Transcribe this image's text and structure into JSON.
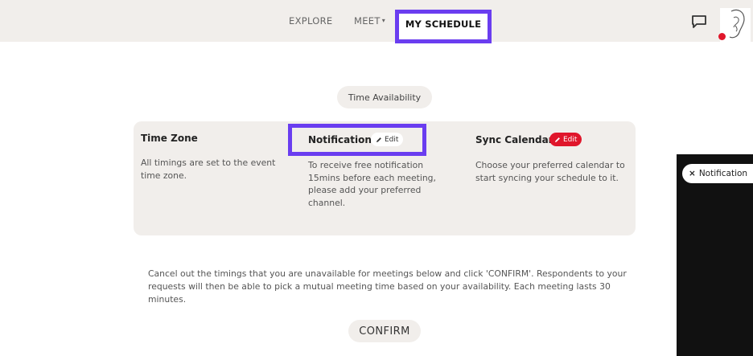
{
  "nav": {
    "explore": "EXPLORE",
    "meet": "MEET",
    "meet_caret": "▾",
    "my_schedule": "MY SCHEDULE"
  },
  "availability": {
    "heading": "Time Availability",
    "time_zone": {
      "title": "Time Zone",
      "text": "All timings are set to the event time zone."
    },
    "notification": {
      "title": "Notification",
      "edit_label": "Edit",
      "text": "To receive free notification 15mins before each meeting, please add your preferred channel."
    },
    "sync_calendar": {
      "title": "Sync Calendar",
      "edit_label": "Edit",
      "text": "Choose your preferred calendar to start syncing your schedule to it."
    }
  },
  "instructions": "Cancel out the timings that you are unavailable for meetings below and click 'CONFIRM'. Respondents to your requests will then be able to pick a mutual meeting time based on your availability. Each meeting lasts 30 minutes.",
  "confirm_label": "CONFIRM",
  "overlay": {
    "close_glyph": "×",
    "chip_label": "Notification"
  },
  "icons": {
    "chat": "chat-bubble-icon",
    "pencil": "pencil-icon",
    "close": "close-icon"
  },
  "colors": {
    "highlight": "#6a3df0",
    "danger": "#e0162b",
    "panel_bg": "#f1eeeb"
  }
}
